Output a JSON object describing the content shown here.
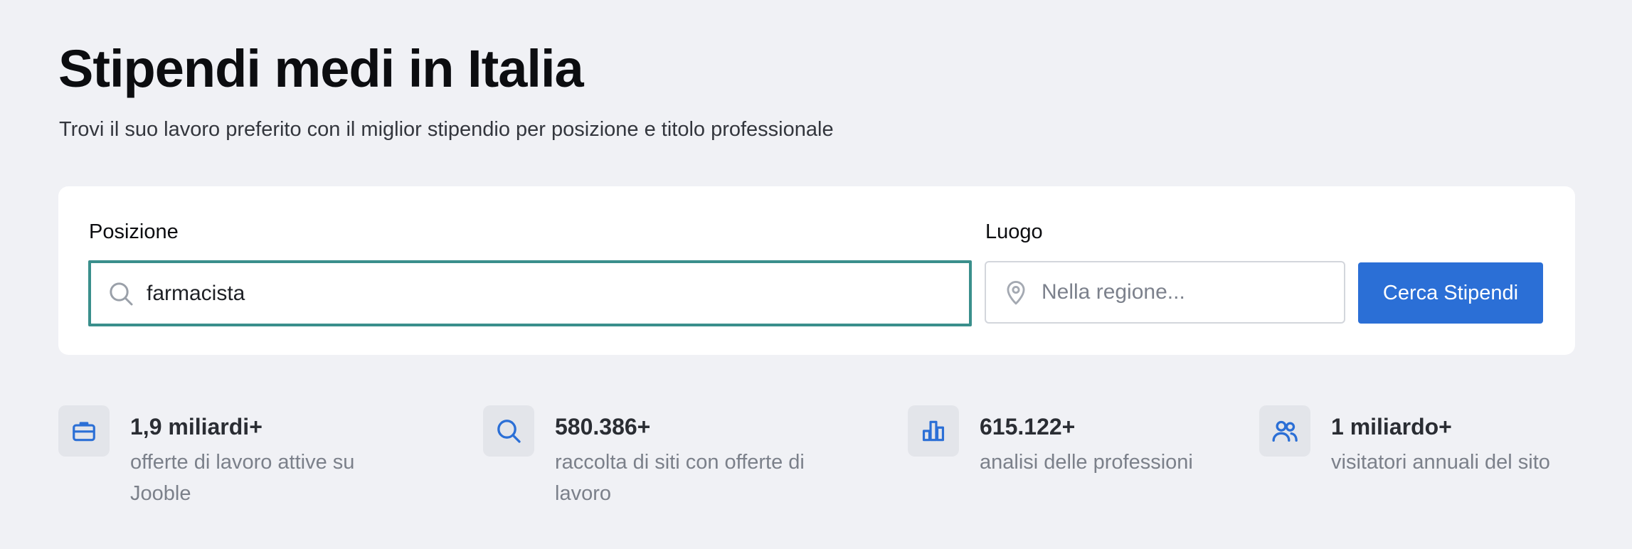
{
  "header": {
    "title": "Stipendi medi in Italia",
    "subtitle": "Trovi il suo lavoro preferito con il miglior stipendio per posizione e titolo professionale"
  },
  "search": {
    "position_label": "Posizione",
    "position_value": "farmacista",
    "location_label": "Luogo",
    "location_placeholder": "Nella regione...",
    "button_label": "Cerca Stipendi"
  },
  "stats": [
    {
      "icon": "briefcase-icon",
      "value": "1,9 miliardi+",
      "description": "offerte di lavoro attive su Jooble"
    },
    {
      "icon": "search-icon",
      "value": "580.386+",
      "description": "raccolta di siti con offerte di lavoro"
    },
    {
      "icon": "bar-chart-icon",
      "value": "615.122+",
      "description": "analisi delle professioni"
    },
    {
      "icon": "users-icon",
      "value": "1 miliardo+",
      "description": "visitatori annuali del sito"
    }
  ],
  "colors": {
    "accent": "#2b6fd6",
    "focus_border": "#3a8f8c",
    "background": "#f0f1f5",
    "icon_blue": "#2b6fd6"
  }
}
